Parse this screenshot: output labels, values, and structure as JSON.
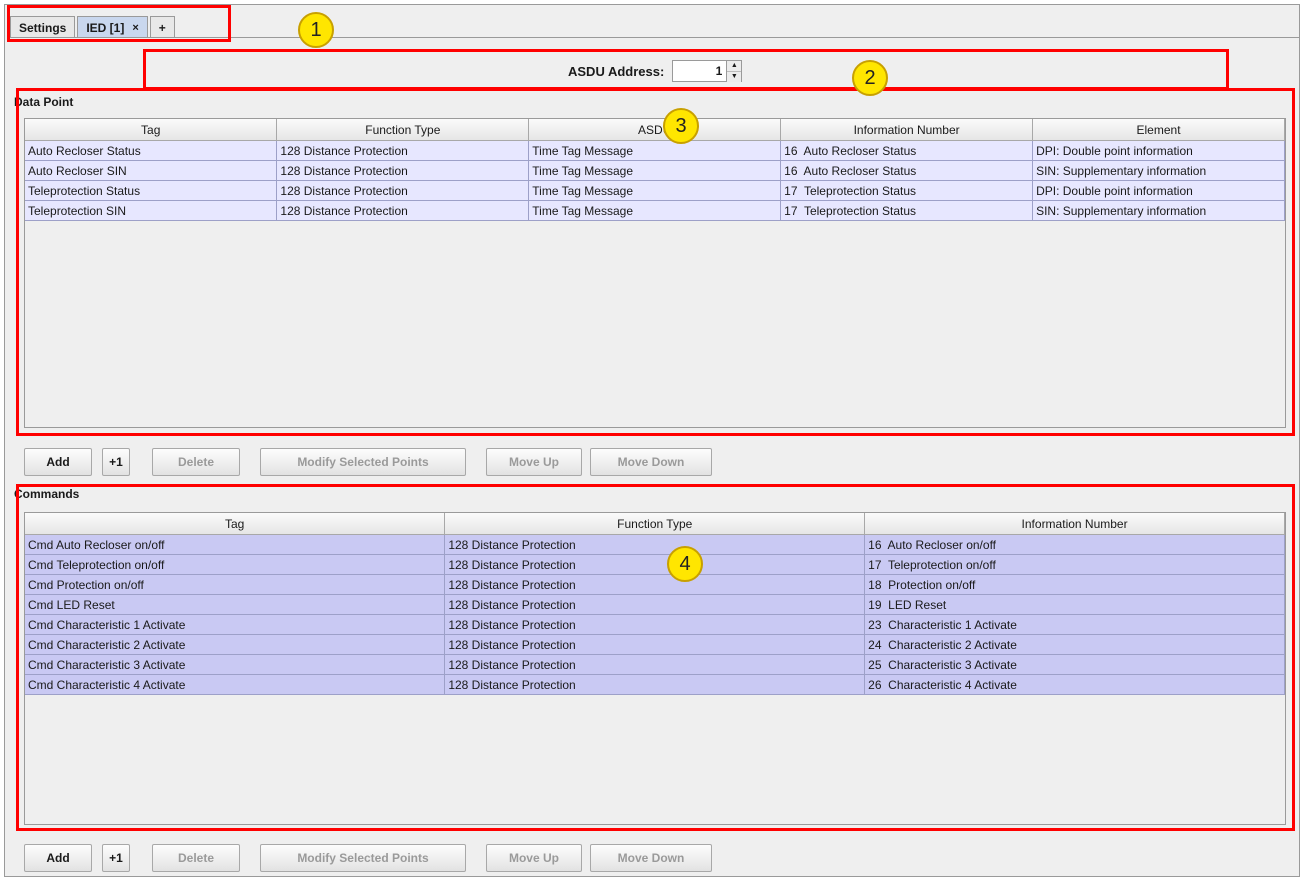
{
  "tabs": [
    {
      "label": "Settings"
    },
    {
      "label": "IED [1]",
      "close": "×"
    },
    {
      "label": "+"
    }
  ],
  "asdu": {
    "label": "ASDU Address:",
    "value": "1"
  },
  "data_point": {
    "title": "Data Point",
    "columns": [
      "Tag",
      "Function Type",
      "ASDU",
      "Information Number",
      "Element"
    ],
    "rows": [
      [
        "Auto Recloser Status",
        "128 Distance Protection",
        "Time Tag Message",
        "16  Auto Recloser Status",
        "DPI: Double point information"
      ],
      [
        "Auto Recloser SIN",
        "128 Distance Protection",
        "Time Tag Message",
        "16  Auto Recloser Status",
        "SIN: Supplementary information"
      ],
      [
        "Teleprotection Status",
        "128 Distance Protection",
        "Time Tag Message",
        "17  Teleprotection Status",
        "DPI: Double point information"
      ],
      [
        "Teleprotection SIN",
        "128 Distance Protection",
        "Time Tag Message",
        "17  Teleprotection Status",
        "SIN: Supplementary information"
      ]
    ]
  },
  "commands": {
    "title": "Commands",
    "columns": [
      "Tag",
      "Function Type",
      "Information Number"
    ],
    "rows": [
      [
        "Cmd Auto Recloser on/off",
        "128 Distance Protection",
        "16  Auto Recloser on/off"
      ],
      [
        "Cmd Teleprotection on/off",
        "128 Distance Protection",
        "17  Teleprotection on/off"
      ],
      [
        "Cmd Protection on/off",
        "128 Distance Protection",
        "18  Protection on/off"
      ],
      [
        "Cmd LED Reset",
        "128 Distance Protection",
        "19  LED Reset"
      ],
      [
        "Cmd Characteristic 1 Activate",
        "128 Distance Protection",
        "23  Characteristic 1 Activate"
      ],
      [
        "Cmd Characteristic 2 Activate",
        "128 Distance Protection",
        "24  Characteristic 2 Activate"
      ],
      [
        "Cmd Characteristic 3 Activate",
        "128 Distance Protection",
        "25  Characteristic 3 Activate"
      ],
      [
        "Cmd Characteristic 4 Activate",
        "128 Distance Protection",
        "26  Characteristic 4 Activate"
      ]
    ]
  },
  "buttons": {
    "add": "Add",
    "plus_one": "+1",
    "delete": "Delete",
    "modify": "Modify Selected Points",
    "move_up": "Move Up",
    "move_down": "Move Down"
  },
  "annotations": [
    "1",
    "2",
    "3",
    "4"
  ],
  "colors": {
    "annotation_box": "#ff0000",
    "badge": "#ffe600",
    "dp_row": "#e7e7ff",
    "cmd_row": "#c9c9f3",
    "active_tab": "#c9d7ee"
  }
}
